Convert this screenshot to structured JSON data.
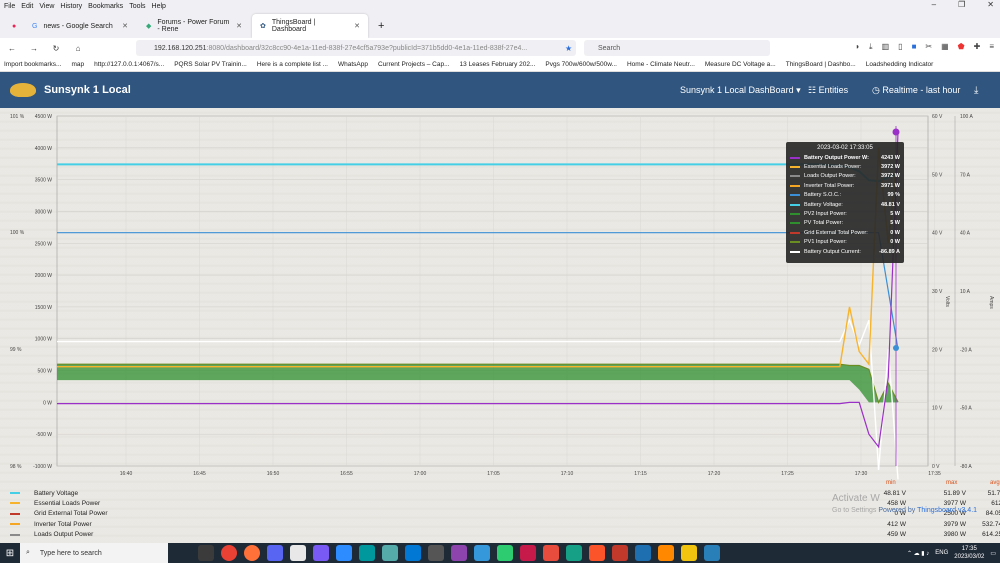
{
  "menu": [
    "File",
    "Edit",
    "View",
    "History",
    "Bookmarks",
    "Tools",
    "Help"
  ],
  "tabs": [
    {
      "label": "news - Google Search",
      "active": false
    },
    {
      "label": "Forums - Power Forum - Rene",
      "active": false
    },
    {
      "label": "ThingsBoard | Dashboard",
      "active": true
    }
  ],
  "url": {
    "host": "192.168.120.251",
    "rest": ":8080/dashboard/32c8cc90-4e1a-11ed-838f-27e4cf5a793e?publicId=371b5dd0-4e1a-11ed-838f-27e4..."
  },
  "search_placeholder": "Search",
  "bookmarks": [
    "Import bookmarks...",
    "map",
    "http://127.0.0.1:4067/s...",
    "PQRS Solar PV Trainin...",
    "Here is a complete list ...",
    "WhatsApp",
    "Current Projects – Cap...",
    "13 Leases February 202...",
    "Pvgs 700w/600w/500w...",
    "Home - Climate Neutr...",
    "Measure DC Voltage a...",
    "ThingsBoard | Dashbo...",
    "Loadshedding Indicator"
  ],
  "app": {
    "title": "Sunsynk 1 Local",
    "dashboard_select": "Sunsynk 1 Local DashBoard",
    "entities": "Entities",
    "realtime": "Realtime - last hour"
  },
  "chart_data": {
    "type": "line",
    "x_ticks": [
      "16:40",
      "16:45",
      "16:50",
      "16:55",
      "17:00",
      "17:05",
      "17:10",
      "17:15",
      "17:20",
      "17:25",
      "17:30",
      "17:35"
    ],
    "y_left_ticks": [
      "4500 W",
      "4000 W",
      "3500 W",
      "3000 W",
      "2500 W",
      "2000 W",
      "1500 W",
      "1000 W",
      "500 W",
      "0 W",
      "-500 W",
      "-1000 W"
    ],
    "y_pct_ticks": [
      "101 %",
      "100 %",
      "99 %",
      "98 %"
    ],
    "y_volts_ticks": [
      "60 V",
      "50 V",
      "40 V",
      "30 V",
      "20 V",
      "10 V",
      "0 V"
    ],
    "y_volts_label": "Volts",
    "y_amps_ticks": [
      "100 A",
      "70 A",
      "40 A",
      "10 A",
      "-20 A",
      "-50 A",
      "-80 A"
    ],
    "y_amps_label": "Amps",
    "colors": {
      "battery_voltage": "#45cfe6",
      "essential_loads": "#f7b32b",
      "grid_external": "#c0392b",
      "inverter_total": "#f5a623",
      "loads_output": "#8a8a8a",
      "battery_output_power": "#9b30c8",
      "battery_soc": "#3b8fd6",
      "pv2": "#2f8f2f",
      "pv_total": "#2f8f2f",
      "pv1": "#6b8e23",
      "battery_current": "#ffffff"
    },
    "series": [
      {
        "name": "Battery Voltage",
        "y": [
          51.7,
          51.7,
          51.7,
          51.7,
          51.7,
          51.7,
          51.7,
          51.7,
          51.7,
          51.7,
          51.7,
          51.5,
          51.2,
          50.5,
          49.0,
          48.8,
          49.5,
          50.1
        ]
      },
      {
        "name": "Battery S.O.C.",
        "y": [
          100,
          100,
          100,
          100,
          100,
          100,
          100,
          100,
          100,
          100,
          100,
          100,
          100,
          100,
          100,
          100,
          99.5,
          99
        ]
      },
      {
        "name": "Battery Output Current",
        "y": [
          -16,
          -16,
          -16,
          -16,
          -16,
          -16,
          -16,
          -16,
          -16,
          -16,
          -16,
          -16,
          -5,
          -18,
          -5,
          -82,
          -20,
          -86.89
        ]
      },
      {
        "name": "Essential Loads Power",
        "y": [
          560,
          560,
          560,
          560,
          560,
          560,
          560,
          560,
          560,
          560,
          560,
          560,
          1500,
          800,
          600,
          4000,
          2500,
          3972
        ]
      },
      {
        "name": "Battery Output Power",
        "y": [
          -20,
          -20,
          -20,
          -20,
          -20,
          -20,
          -20,
          -20,
          -20,
          -20,
          -20,
          -20,
          0,
          0,
          -500,
          -700,
          400,
          4243
        ]
      }
    ]
  },
  "tooltip": {
    "time": "2023-03-02 17:33:05",
    "rows": [
      {
        "label": "Battery Output Power W:",
        "value": "4243 W",
        "color": "#9b30c8",
        "bold": true
      },
      {
        "label": "Essential Loads Power:",
        "value": "3972 W",
        "color": "#f7b32b"
      },
      {
        "label": "Loads Output Power:",
        "value": "3972 W",
        "color": "#8a8a8a"
      },
      {
        "label": "Inverter Total Power:",
        "value": "3971 W",
        "color": "#f5a623"
      },
      {
        "label": "Battery S.O.C.:",
        "value": "99 %",
        "color": "#3b8fd6"
      },
      {
        "label": "Battery Voltage:",
        "value": "48.81 V",
        "color": "#45cfe6"
      },
      {
        "label": "PV2 Input Power:",
        "value": "5 W",
        "color": "#2f8f2f"
      },
      {
        "label": "PV Total Power:",
        "value": "5 W",
        "color": "#2f8f2f"
      },
      {
        "label": "Grid External Total Power:",
        "value": "0 W",
        "color": "#c0392b"
      },
      {
        "label": "PV1 Input Power:",
        "value": "0 W",
        "color": "#6b8e23"
      },
      {
        "label": "Battery Output Current:",
        "value": "-86.89 A",
        "color": "#ffffff"
      }
    ]
  },
  "legend": {
    "headers": {
      "min": "min",
      "max": "max",
      "avg": "avg"
    },
    "rows": [
      {
        "name": "Battery Voltage",
        "color": "#45cfe6",
        "min": "48.81 V",
        "max": "51.89 V",
        "avg": "51.71 V"
      },
      {
        "name": "Essential Loads Power",
        "color": "#f7b32b",
        "min": "458 W",
        "max": "3977 W",
        "avg": "612 W"
      },
      {
        "name": "Grid External Total Power",
        "color": "#c0392b",
        "min": "0 W",
        "max": "2500 W",
        "avg": "84.05 W"
      },
      {
        "name": "Inverter Total Power",
        "color": "#f5a623",
        "min": "412 W",
        "max": "3979 W",
        "avg": "532.74 W"
      },
      {
        "name": "Loads Output Power",
        "color": "#8a8a8a",
        "min": "459 W",
        "max": "3980 W",
        "avg": "614.25 W"
      }
    ]
  },
  "watermark": {
    "line1": "Activate W",
    "line2": "Go to Settings",
    "brand": "Powered by",
    "product": "Thingsboard v3.4.1"
  },
  "taskbar": {
    "search": "Type here to search",
    "lang": "ENG",
    "time": "17:35",
    "date": "2023/03/02"
  }
}
